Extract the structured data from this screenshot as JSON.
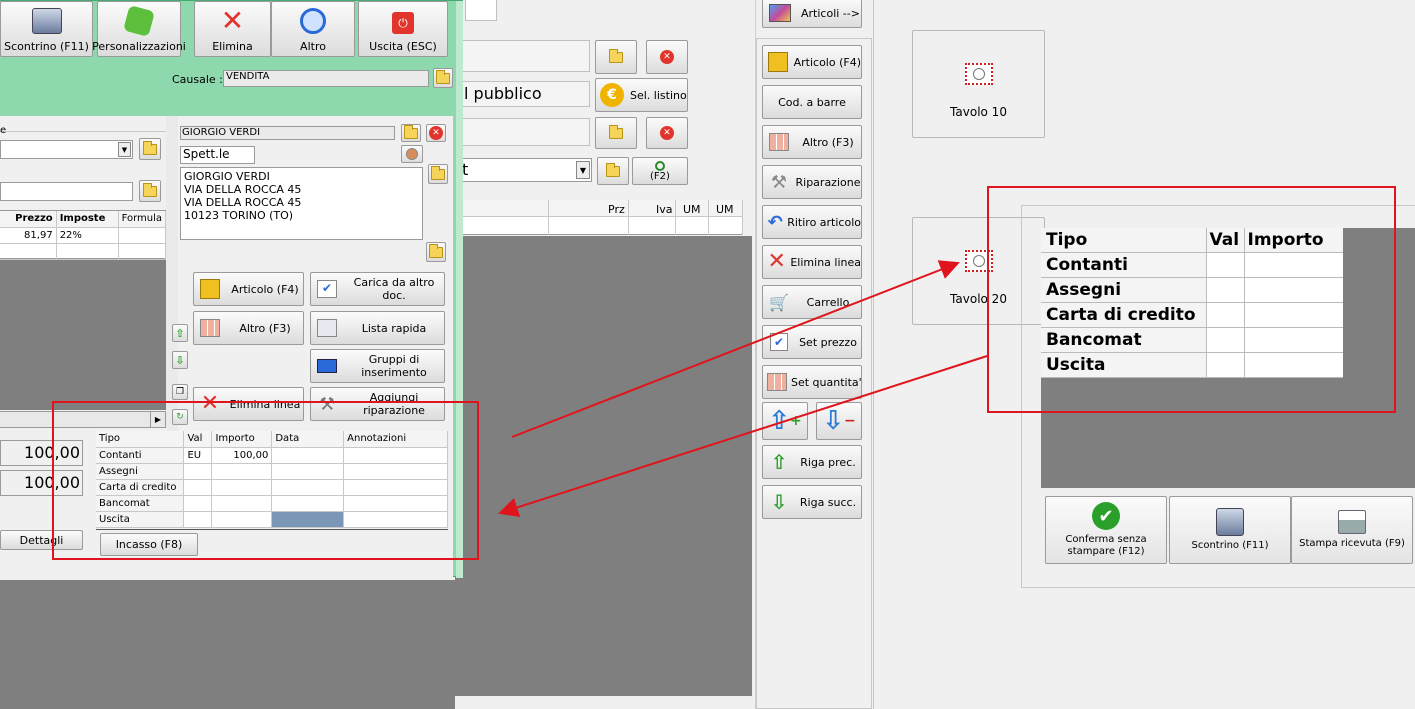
{
  "left_window": {
    "toolbar": [
      "Scontrino (F11)",
      "Personalizzazioni",
      "Elimina",
      "Altro",
      "Uscita (ESC)"
    ],
    "causale_label": "Causale :",
    "causale_value": "VENDITA",
    "customer_name": "GIORGIO VERDI",
    "salutation": "Spett.le",
    "address": [
      "GIORGIO VERDI",
      "VIA DELLA ROCCA 45",
      "VIA DELLA ROCCA 45",
      "10123 TORINO (TO)"
    ],
    "grid_headers": [
      "Prezzo",
      "Imposte",
      "Formula"
    ],
    "grid_row": [
      "81,97",
      "22%",
      ""
    ],
    "total_1": "100,00",
    "total_2": "100,00",
    "dettagli": "Dettagli",
    "action_buttons": [
      "Articolo (F4)",
      "Carica da altro doc.",
      "Altro (F3)",
      "Lista rapida",
      "Gruppi di inserimento",
      "Elimina linea",
      "Aggiungi riparazione"
    ],
    "payments": {
      "headers": [
        "Tipo",
        "Val",
        "Importo",
        "Data",
        "Annotazioni"
      ],
      "rows": [
        [
          "Contanti",
          "EU",
          "100,00",
          "",
          ""
        ],
        [
          "Assegni",
          "",
          "",
          "",
          ""
        ],
        [
          "Carta di credito",
          "",
          "",
          "",
          ""
        ],
        [
          "Bancomat",
          "",
          "",
          "",
          ""
        ],
        [
          "Uscita",
          "",
          "",
          "",
          ""
        ]
      ]
    },
    "incasso": "Incasso (F8)"
  },
  "middle": {
    "pubblico_text": "l pubblico",
    "sel_listino": "Sel. listino",
    "t_text": "t",
    "f2": "(F2)",
    "grid_headers": [
      "Prz",
      "Iva",
      "UM",
      "UM"
    ]
  },
  "right_toolbar": {
    "articoli": "Articoli -->",
    "buttons": [
      "Articolo (F4)",
      "Cod. a barre",
      "Altro (F3)",
      "Riparazione",
      "Ritiro articolo",
      "Elimina linea",
      "Carrello",
      "Set prezzo",
      "Set quantita'",
      "",
      "Riga prec.",
      "Riga succ."
    ]
  },
  "tables": [
    "Tavolo 10",
    "Tavolo 20"
  ],
  "zoom_payments": {
    "headers": [
      "Tipo",
      "Val",
      "Importo"
    ],
    "rows": [
      "Contanti",
      "Assegni",
      "Carta di credito",
      "Bancomat",
      "Uscita"
    ]
  },
  "bottom_buttons": [
    "Conferma senza stampare (F12)",
    "Scontrino (F11)",
    "Stampa ricevuta (F9)"
  ],
  "colors": {
    "accent_green": "#8ed8ae",
    "annotation_red": "#e0141c",
    "dark_gray": "#7f7f7f"
  }
}
